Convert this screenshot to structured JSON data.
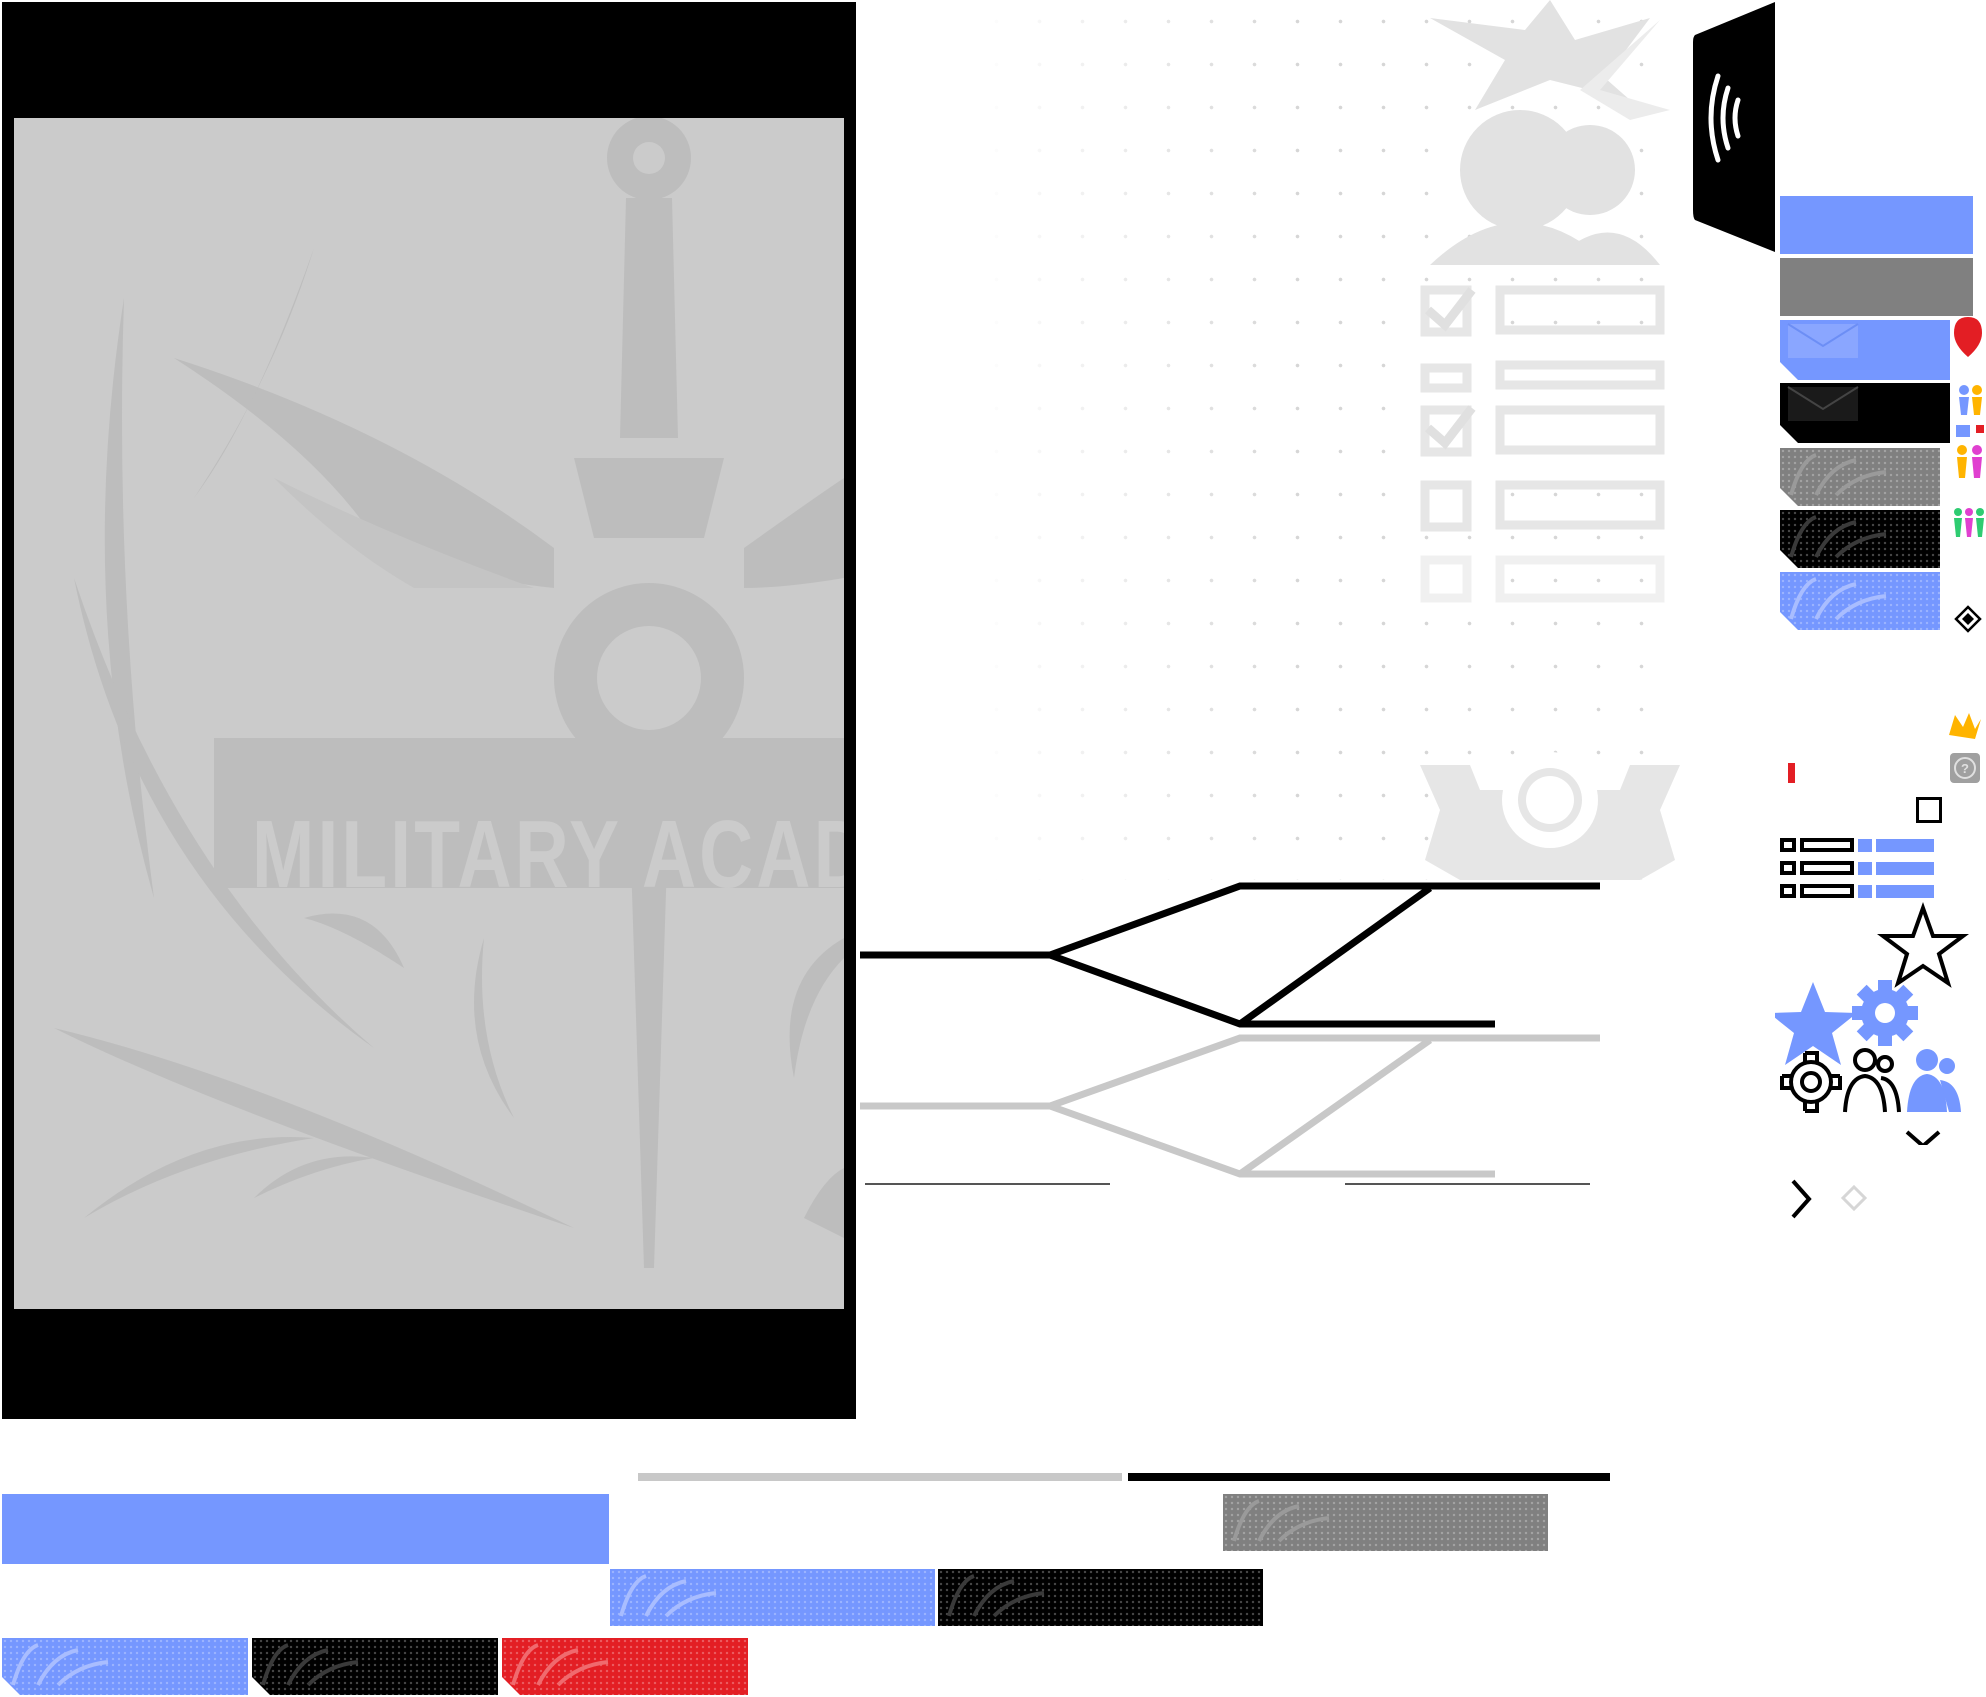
{
  "card": {
    "banner_text": "MILITARY ACAD"
  },
  "colors": {
    "accent_blue": "#7597ff",
    "grey": "#808080",
    "black": "#000000",
    "red": "#e31e24",
    "emblem_bg": "#cbcbcb",
    "emblem_fg": "#bdbdbd",
    "line_grey": "#c8c8c8"
  },
  "icons": [
    "wifi-signal-icon",
    "map-pin-icon",
    "people-icon",
    "diamond-icon",
    "crown-icon",
    "help-icon",
    "checkbox-icon",
    "list-icon",
    "star-outline-icon",
    "star-filled-icon",
    "gear-filled-icon",
    "gear-outline-icon",
    "user-group-outline-icon",
    "user-group-filled-icon",
    "chevron-down-icon",
    "chevron-right-icon",
    "diamond-outline-icon",
    "check-icon"
  ]
}
